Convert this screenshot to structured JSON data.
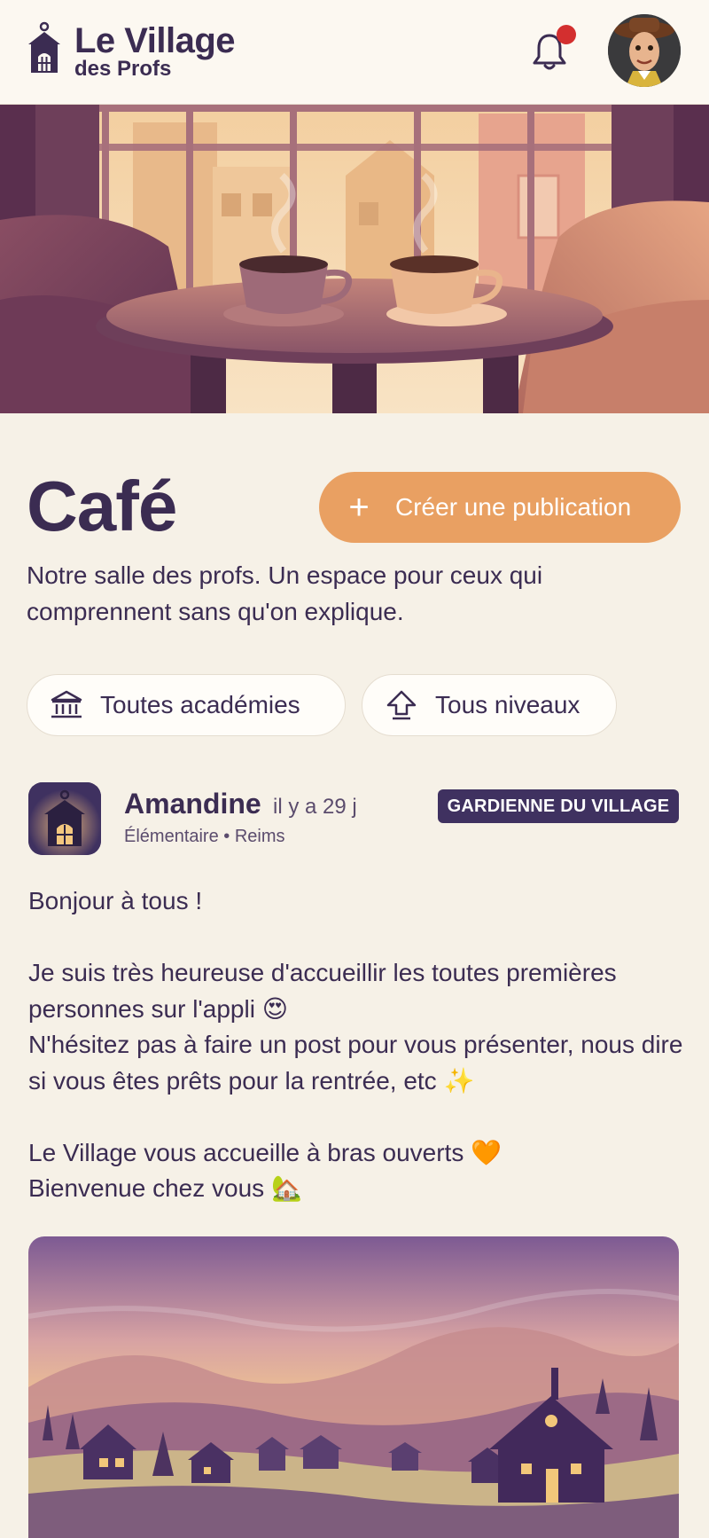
{
  "header": {
    "logo_title": "Le Village",
    "logo_subtitle": "des Profs",
    "notification_icon": "bell-icon",
    "has_notification": true
  },
  "page": {
    "title": "Café",
    "create_button_label": "Créer une publication",
    "intro": "Notre salle des profs. Un espace pour ceux qui comprennent sans qu'on explique."
  },
  "filters": [
    {
      "label": "Toutes académies",
      "icon": "institution-icon"
    },
    {
      "label": "Tous niveaux",
      "icon": "level-up-icon"
    }
  ],
  "post": {
    "author": "Amandine",
    "time": "il y a 29 j",
    "meta": "Élémentaire • Reims",
    "badge": "GARDIENNE DU VILLAGE",
    "body": "Bonjour à tous !\n\nJe suis très heureuse d'accueillir les toutes premières personnes sur l'appli 😍\nN'hésitez pas à faire un post pour vous présenter, nous dire si vous êtes prêts pour la rentrée, etc ✨\n\nLe Village vous accueille à bras ouverts 🧡\nBienvenue chez vous 🏡"
  },
  "colors": {
    "brand": "#3b2c52",
    "accent": "#e9a062",
    "background": "#f6f1e7",
    "notification": "#d32f2f"
  }
}
